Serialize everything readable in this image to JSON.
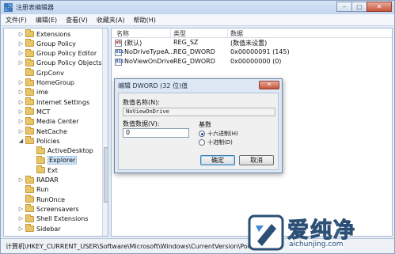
{
  "window": {
    "title": "注册表编辑器",
    "buttons": {
      "minimize": "–",
      "maximize": "□",
      "close": "✕"
    }
  },
  "menu": [
    "文件(F)",
    "编辑(E)",
    "查看(V)",
    "收藏夹(A)",
    "帮助(H)"
  ],
  "tree": {
    "items": [
      {
        "label": "Extensions",
        "expander": "▷"
      },
      {
        "label": "Group Policy",
        "expander": "▷"
      },
      {
        "label": "Group Policy Editor",
        "expander": "▷"
      },
      {
        "label": "Group Policy Objects",
        "expander": "▷"
      },
      {
        "label": "GrpConv",
        "expander": ""
      },
      {
        "label": "HomeGroup",
        "expander": "▷"
      },
      {
        "label": "ime",
        "expander": "▷"
      },
      {
        "label": "Internet Settings",
        "expander": "▷"
      },
      {
        "label": "MCT",
        "expander": "▷"
      },
      {
        "label": "Media Center",
        "expander": "▷"
      },
      {
        "label": "NetCache",
        "expander": "▷"
      },
      {
        "label": "Policies",
        "expander": "◢"
      },
      {
        "label": "ActiveDesktop",
        "expander": ""
      },
      {
        "label": "Explorer",
        "expander": ""
      },
      {
        "label": "Ext",
        "expander": ""
      },
      {
        "label": "RADAR",
        "expander": "▷"
      },
      {
        "label": "Run",
        "expander": ""
      },
      {
        "label": "RunOnce",
        "expander": ""
      },
      {
        "label": "Screensavers",
        "expander": "▷"
      },
      {
        "label": "Shell Extensions",
        "expander": "▷"
      },
      {
        "label": "Sidebar",
        "expander": "▷"
      }
    ]
  },
  "list": {
    "columns": {
      "name": "名称",
      "type": "类型",
      "data": "数据"
    },
    "rows": [
      {
        "icon": "ab",
        "name": "(默认)",
        "type": "REG_SZ",
        "data": "(数值未设置)"
      },
      {
        "icon": "011",
        "name": "NoDriveTypeA...",
        "type": "REG_DWORD",
        "data": "0x00000091 (145)"
      },
      {
        "icon": "011",
        "name": "NoViewOnDrive",
        "type": "REG_DWORD",
        "data": "0x00000000 (0)"
      }
    ]
  },
  "status": "计算机\\HKEY_CURRENT_USER\\Software\\Microsoft\\Windows\\CurrentVersion\\Policies\\E",
  "dialog": {
    "title": "编辑 DWORD (32 位)值",
    "close": "✕",
    "name_label": "数值名称(N):",
    "name_value": "NoViewOnDrive",
    "data_label": "数值数据(V):",
    "data_value": "0",
    "base_label": "基数",
    "base_options": [
      {
        "label": "十六进制(H)",
        "selected": true
      },
      {
        "label": "十进制(D)",
        "selected": false
      }
    ],
    "ok": "确定",
    "cancel": "取消"
  },
  "watermark": {
    "title": "爱纯净",
    "url": "aichunjing.com"
  },
  "colors": {
    "selection": "#cde3f7",
    "folder": "#e8c568",
    "close_button": "#c8553c"
  }
}
